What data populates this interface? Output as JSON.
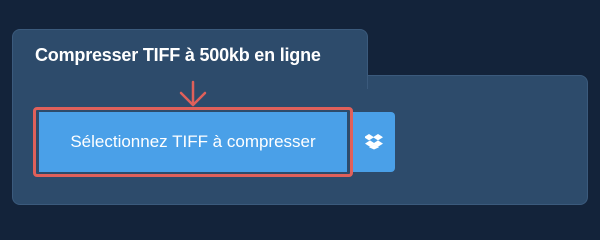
{
  "tool": {
    "title": "Compresser TIFF à 500kb en ligne",
    "select_button_label": "Sélectionnez TIFF à compresser",
    "dropbox_icon": "dropbox-icon",
    "arrow_icon": "arrow-down-icon"
  },
  "colors": {
    "background": "#13233a",
    "panel": "#2d4b6b",
    "button": "#4aa0e8",
    "highlight": "#e0605a",
    "text": "#ffffff"
  }
}
